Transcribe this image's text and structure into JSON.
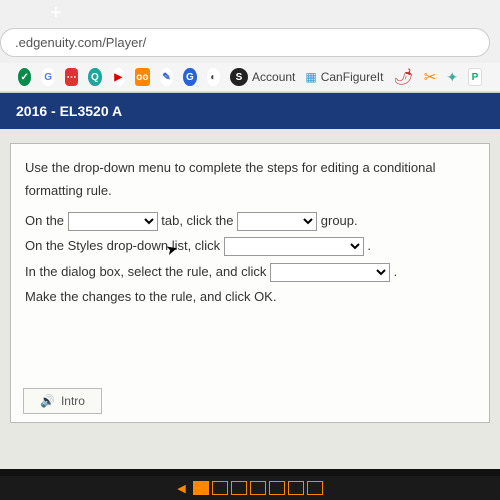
{
  "phone": {
    "plus": "+"
  },
  "browser": {
    "url": ".edgenuity.com/Player/",
    "bookmarks": {
      "account": "Account",
      "canfigureit": "CanFigureIt",
      "p_label": "P"
    }
  },
  "course": {
    "header": "2016 - EL3520 A"
  },
  "lesson": {
    "instruction": "Use the drop-down menu to complete the steps for editing a conditional formatting rule.",
    "line1_a": "On the ",
    "line1_b": " tab, click the ",
    "line1_c": " group.",
    "line2_a": "On the Styles drop-down list, click ",
    "line2_b": ".",
    "line3_a": "In the dialog box, select the rule, and click ",
    "line3_b": ".",
    "line4": "Make the changes to the rule, and click OK.",
    "intro_button": "Intro"
  }
}
